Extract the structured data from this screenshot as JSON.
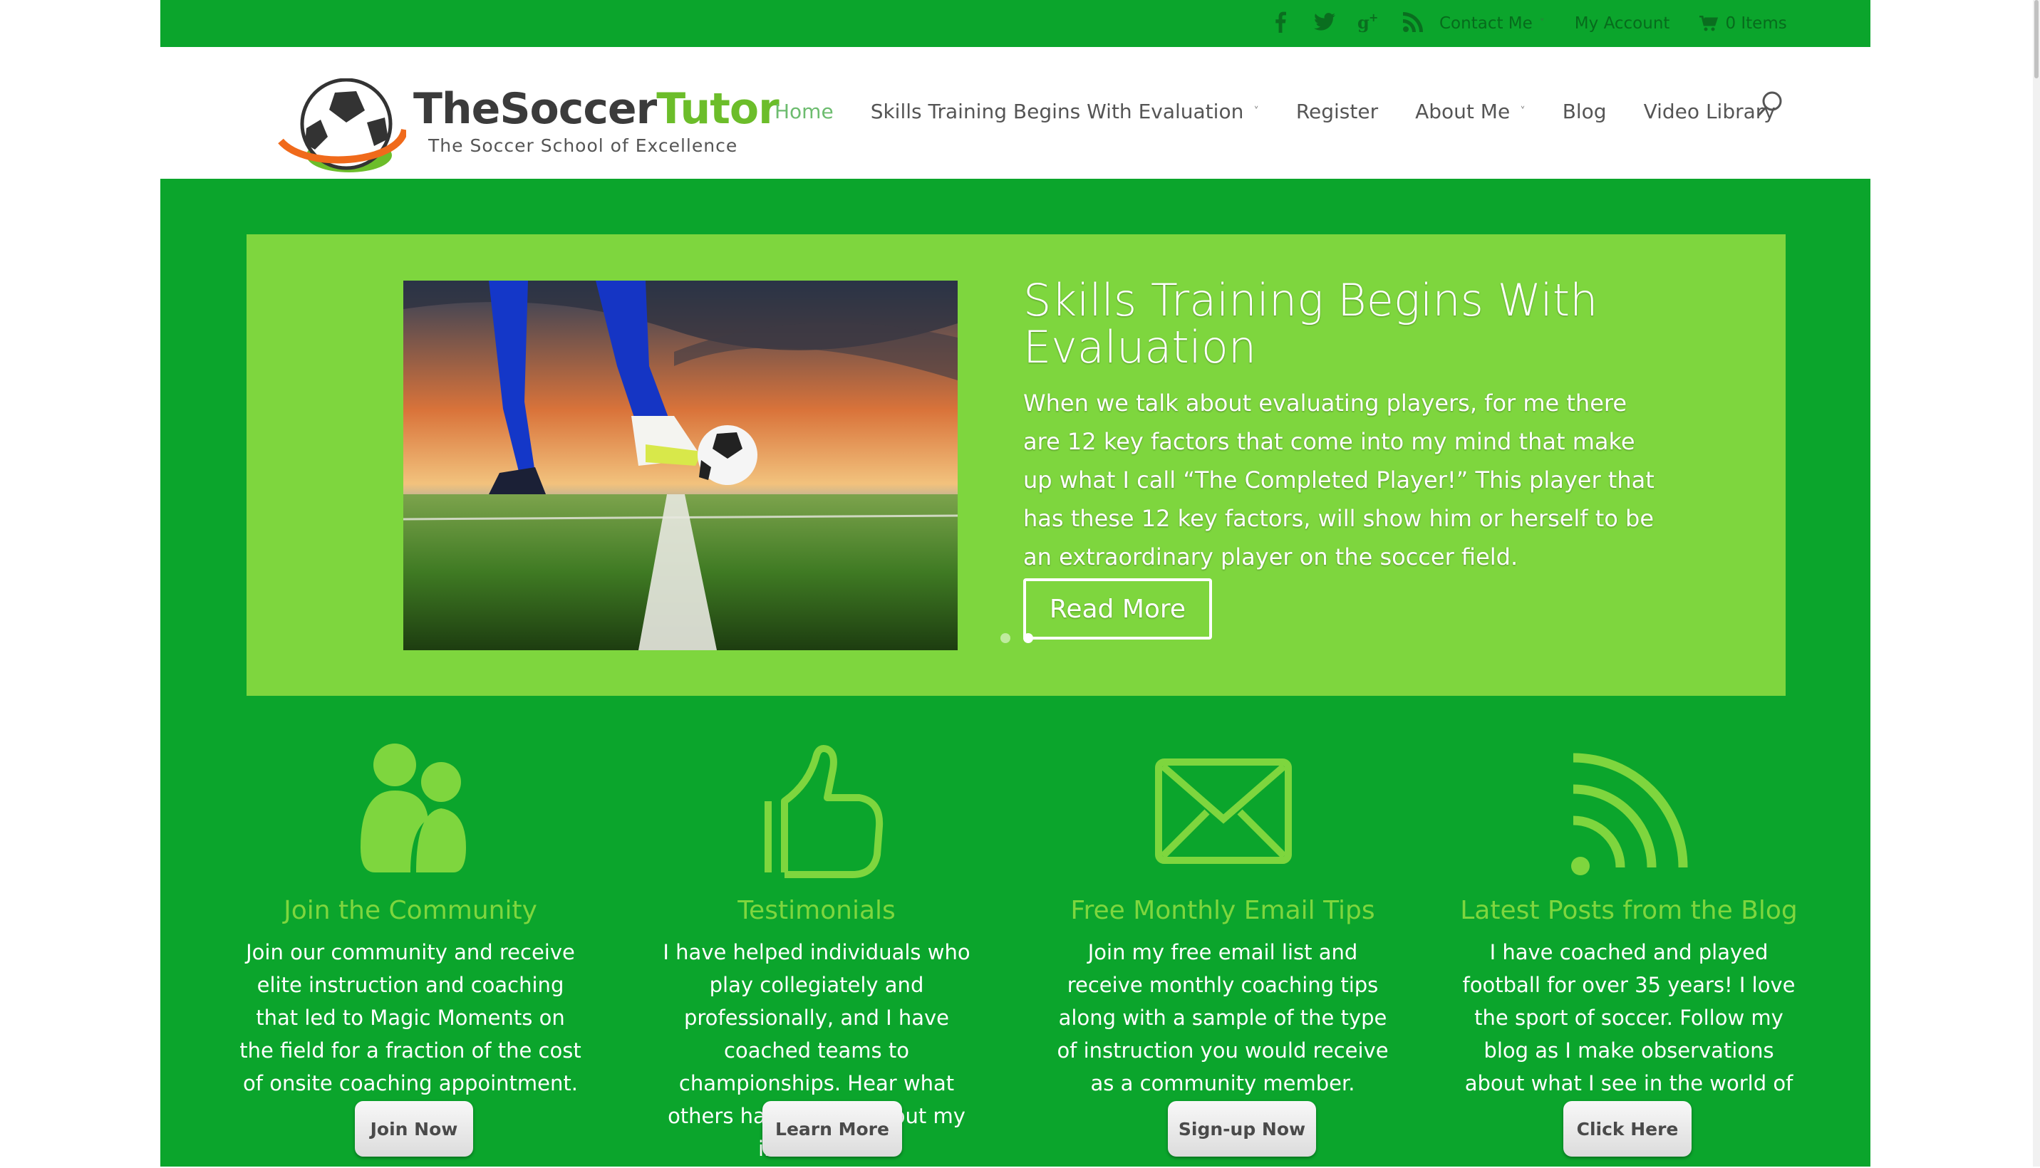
{
  "topbar": {
    "social": [
      "facebook-icon",
      "twitter-icon",
      "google-plus-icon",
      "rss-icon"
    ],
    "contact": "Contact Me",
    "account": "My Account",
    "cart": "0 Items"
  },
  "logo": {
    "name_part1": "TheSoccer",
    "name_part2": "Tutor",
    "tagline": "The Soccer School of Excellence"
  },
  "nav": {
    "items": [
      {
        "label": "Home",
        "active": true
      },
      {
        "label": "Skills Training Begins With Evaluation",
        "dropdown": true
      },
      {
        "label": "Register"
      },
      {
        "label": "About Me",
        "dropdown": true
      },
      {
        "label": "Blog"
      },
      {
        "label": "Video Library"
      }
    ]
  },
  "hero": {
    "title": "Skills Training Begins With Evaluation",
    "text": "When we talk about evaluating players, for me there are 12 key factors that come into my mind that make up what I call “The Completed Player!”  This player that has these 12 key factors, will show him or herself to be an extraordinary player on the soccer field.",
    "button": "Read More",
    "slides": 2,
    "active_slide": 2
  },
  "features": [
    {
      "icon": "community-icon",
      "title": "Join the Community",
      "text": "Join our community and receive elite instruction and coaching that led to Magic Moments on the field for a fraction of the cost of onsite coaching appointment.",
      "button": "Join Now"
    },
    {
      "icon": "thumbs-up-icon",
      "title": "Testimonials",
      "text": "I have helped individuals who play collegiately and professionally, and I have coached teams to championships. Hear what others have to say about my instruction.",
      "button": "Learn More"
    },
    {
      "icon": "envelope-icon",
      "title": "Free Monthly Email Tips",
      "text": "Join my free email list and receive monthly coaching tips along with a sample of the type of instruction you would receive as a community member.",
      "button": "Sign-up Now"
    },
    {
      "icon": "rss-icon",
      "title": "Latest Posts from the Blog",
      "text": "I have coached and played football for over 35 years! I love the sport of soccer. Follow my blog as I make observations about what I see in the world of soccer.",
      "button": "Click Here"
    }
  ],
  "colors": {
    "primary_green": "#0ba52c",
    "light_green": "#7ed63e",
    "nav_active": "#6dbc6f"
  }
}
